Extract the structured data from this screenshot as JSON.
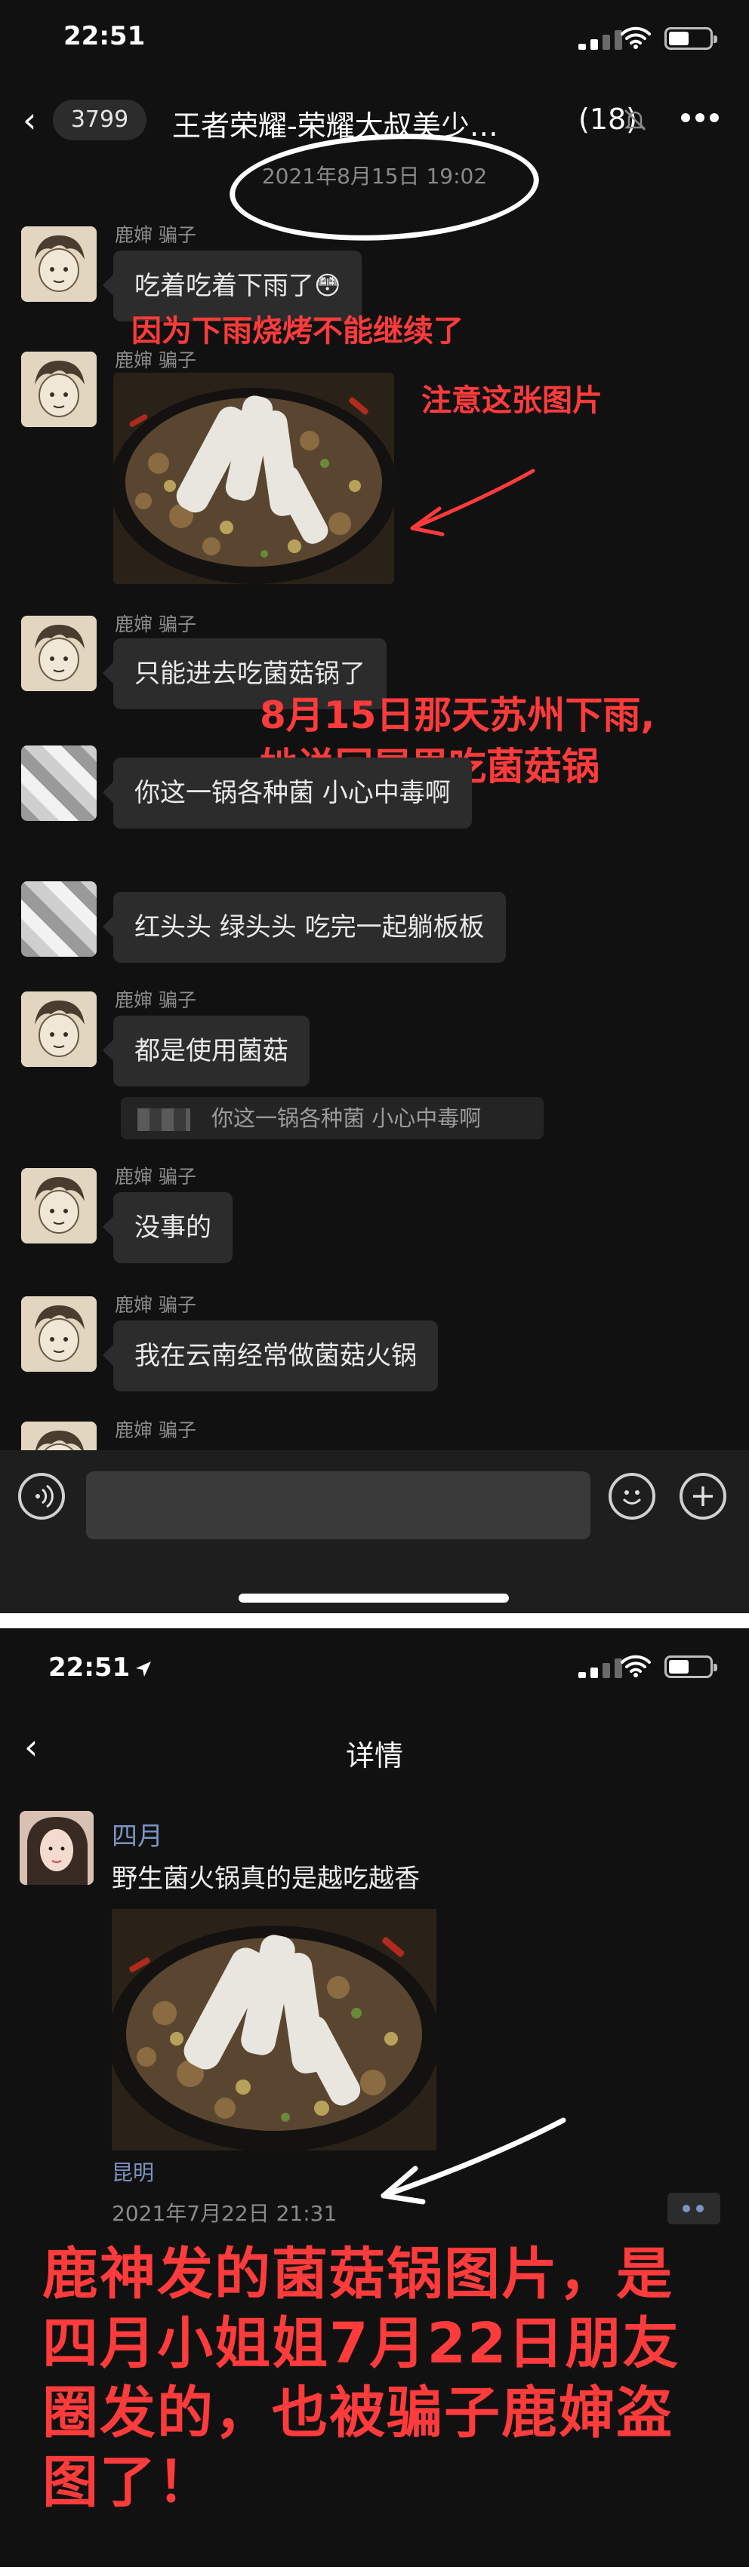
{
  "panel1": {
    "status": {
      "time": "22:51"
    },
    "nav": {
      "back_icon": "chevron-left-icon",
      "unread": "3799",
      "title": "王者荣耀-荣耀大叔美少…",
      "count": "(18)",
      "mute_icon": "bell-off-icon",
      "more_icon": "more-icon"
    },
    "timestamp": "2021年8月15日 19:02",
    "messages": [
      {
        "sender": "鹿婶 骗子",
        "text": "吃着吃着下雨了😳"
      },
      {
        "sender": "鹿婶 骗子",
        "image": "mushroom-hotpot-photo"
      },
      {
        "sender": "鹿婶 骗子",
        "text": "只能进去吃菌菇锅了"
      },
      {
        "sender": "",
        "text": "你这一锅各种菌 小心中毒啊"
      },
      {
        "sender": "",
        "text": "红头头  绿头头 吃完一起躺板板"
      },
      {
        "sender": "鹿婶 骗子",
        "text": "都是使用菌菇",
        "quote": "你这一锅各种菌 小心中毒啊"
      },
      {
        "sender": "鹿婶 骗子",
        "text": "没事的"
      },
      {
        "sender": "鹿婶 骗子",
        "text": "我在云南经常做菌菇火锅"
      },
      {
        "sender": "鹿婶 骗子"
      }
    ],
    "annotations": {
      "rain": "因为下雨烧烤不能继续了",
      "photo": "注意这张图片",
      "suzhou_line1": "8月15日那天苏州下雨,",
      "suzhou_line2": "她说回屋里吃菌菇锅"
    },
    "input": {
      "voice_icon": "voice-icon",
      "emoji_icon": "emoji-icon",
      "plus_icon": "plus-icon"
    }
  },
  "panel2": {
    "status": {
      "time": "22:51"
    },
    "nav": {
      "back_icon": "chevron-left-icon",
      "title": "详情"
    },
    "moment": {
      "name": "四月",
      "text": "野生菌火锅真的是越吃越香",
      "image": "mushroom-hotpot-photo",
      "location": "昆明",
      "date": "2021年7月22日 21:31",
      "more_icon": "more-dots-icon"
    },
    "annotation": "鹿神发的菌菇锅图片，是四月小姐姐7月22日朋友圈发的，也被骗子鹿婶盗图了！"
  },
  "colors": {
    "background": "#111111",
    "bubble": "#2c2c2c",
    "annotation_red": "#ff3b3b",
    "link_blue": "#7d93c2"
  }
}
